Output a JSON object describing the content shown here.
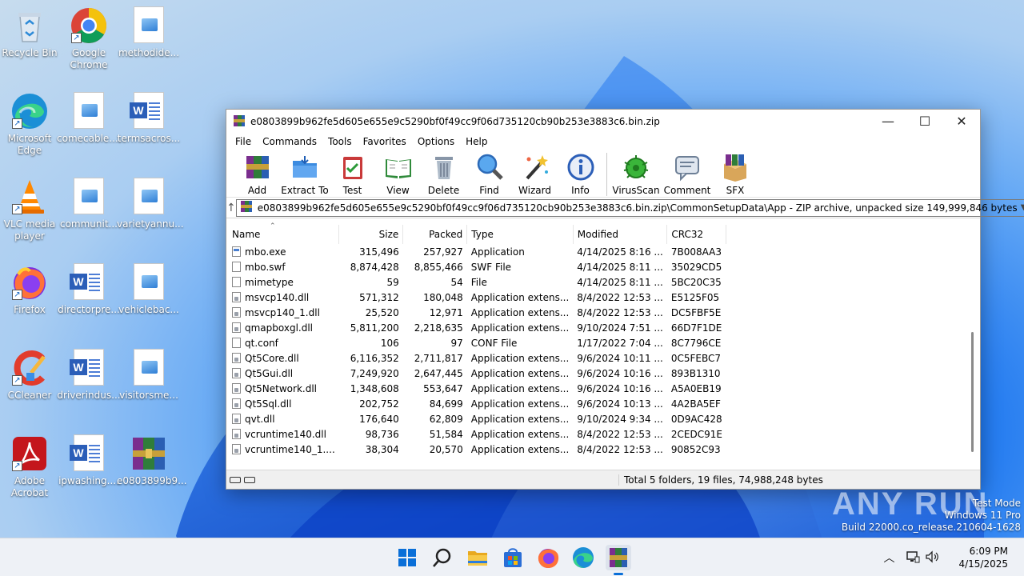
{
  "desktop": {
    "icons": [
      {
        "label": "Recycle Bin"
      },
      {
        "label": "Google Chrome"
      },
      {
        "label": "methodide..."
      },
      {
        "label": "Microsoft Edge"
      },
      {
        "label": "comecable...."
      },
      {
        "label": "termsacros..."
      },
      {
        "label": "VLC media player"
      },
      {
        "label": "communit..."
      },
      {
        "label": "varietyannu..."
      },
      {
        "label": "Firefox"
      },
      {
        "label": "directorpre..."
      },
      {
        "label": "vehiclebac..."
      },
      {
        "label": "CCleaner"
      },
      {
        "label": "driverindus..."
      },
      {
        "label": "visitorsme..."
      },
      {
        "label": "Adobe Acrobat"
      },
      {
        "label": "ipwashing...."
      },
      {
        "label": "e0803899b9..."
      }
    ],
    "watermark": "ANY RUN",
    "test_mode": [
      "Test Mode",
      "Windows 11 Pro",
      "Build 22000.co_release.210604-1628"
    ]
  },
  "window": {
    "title": "e0803899b962fe5d605e655e9c5290bf0f49cc9f06d735120cb90b253e3883c6.bin.zip",
    "controls": {
      "minimize": "—",
      "maximize": "☐",
      "close": "✕"
    },
    "menu": [
      "File",
      "Commands",
      "Tools",
      "Favorites",
      "Options",
      "Help"
    ],
    "toolbar": [
      "Add",
      "Extract To",
      "Test",
      "View",
      "Delete",
      "Find",
      "Wizard",
      "Info",
      "VirusScan",
      "Comment",
      "SFX"
    ],
    "address": "e0803899b962fe5d605e655e9c5290bf0f49cc9f06d735120cb90b253e3883c6.bin.zip\\CommonSetupData\\App - ZIP archive, unpacked size 149,999,846 bytes",
    "columns": [
      "Name",
      "Size",
      "Packed",
      "Type",
      "Modified",
      "CRC32"
    ],
    "files": [
      {
        "name": "mbo.exe",
        "size": "315,496",
        "packed": "257,927",
        "type": "Application",
        "modified": "4/14/2025 8:16 ...",
        "crc": "7B008AA3",
        "icon": "exe"
      },
      {
        "name": "mbo.swf",
        "size": "8,874,428",
        "packed": "8,855,466",
        "type": "SWF File",
        "modified": "4/14/2025 8:11 ...",
        "crc": "35029CD5",
        "icon": "file"
      },
      {
        "name": "mimetype",
        "size": "59",
        "packed": "54",
        "type": "File",
        "modified": "4/14/2025 8:11 ...",
        "crc": "5BC20C35",
        "icon": "file"
      },
      {
        "name": "msvcp140.dll",
        "size": "571,312",
        "packed": "180,048",
        "type": "Application extens...",
        "modified": "8/4/2022 12:53 ...",
        "crc": "E5125F05",
        "icon": "dll"
      },
      {
        "name": "msvcp140_1.dll",
        "size": "25,520",
        "packed": "12,971",
        "type": "Application extens...",
        "modified": "8/4/2022 12:53 ...",
        "crc": "DC5FBF5E",
        "icon": "dll"
      },
      {
        "name": "qmapboxgl.dll",
        "size": "5,811,200",
        "packed": "2,218,635",
        "type": "Application extens...",
        "modified": "9/10/2024 7:51 ...",
        "crc": "66D7F1DE",
        "icon": "dll"
      },
      {
        "name": "qt.conf",
        "size": "106",
        "packed": "97",
        "type": "CONF File",
        "modified": "1/17/2022 7:04 ...",
        "crc": "8C7796CE",
        "icon": "file"
      },
      {
        "name": "Qt5Core.dll",
        "size": "6,116,352",
        "packed": "2,711,817",
        "type": "Application extens...",
        "modified": "9/6/2024 10:11 ...",
        "crc": "0C5FEBC7",
        "icon": "dll"
      },
      {
        "name": "Qt5Gui.dll",
        "size": "7,249,920",
        "packed": "2,647,445",
        "type": "Application extens...",
        "modified": "9/6/2024 10:16 ...",
        "crc": "893B1310",
        "icon": "dll"
      },
      {
        "name": "Qt5Network.dll",
        "size": "1,348,608",
        "packed": "553,647",
        "type": "Application extens...",
        "modified": "9/6/2024 10:16 ...",
        "crc": "A5A0EB19",
        "icon": "dll"
      },
      {
        "name": "Qt5Sql.dll",
        "size": "202,752",
        "packed": "84,699",
        "type": "Application extens...",
        "modified": "9/6/2024 10:13 ...",
        "crc": "4A2BA5EF",
        "icon": "dll"
      },
      {
        "name": "qvt.dll",
        "size": "176,640",
        "packed": "62,809",
        "type": "Application extens...",
        "modified": "9/10/2024 9:34 ...",
        "crc": "0D9AC428",
        "icon": "dll"
      },
      {
        "name": "vcruntime140.dll",
        "size": "98,736",
        "packed": "51,584",
        "type": "Application extens...",
        "modified": "8/4/2022 12:53 ...",
        "crc": "2CEDC91E",
        "icon": "dll"
      },
      {
        "name": "vcruntime140_1....",
        "size": "38,304",
        "packed": "20,570",
        "type": "Application extens...",
        "modified": "8/4/2022 12:53 ...",
        "crc": "90852C93",
        "icon": "dll"
      }
    ],
    "status": "Total 5 folders, 19 files, 74,988,248 bytes"
  },
  "taskbar": {
    "time": "6:09 PM",
    "date": "4/15/2025"
  }
}
